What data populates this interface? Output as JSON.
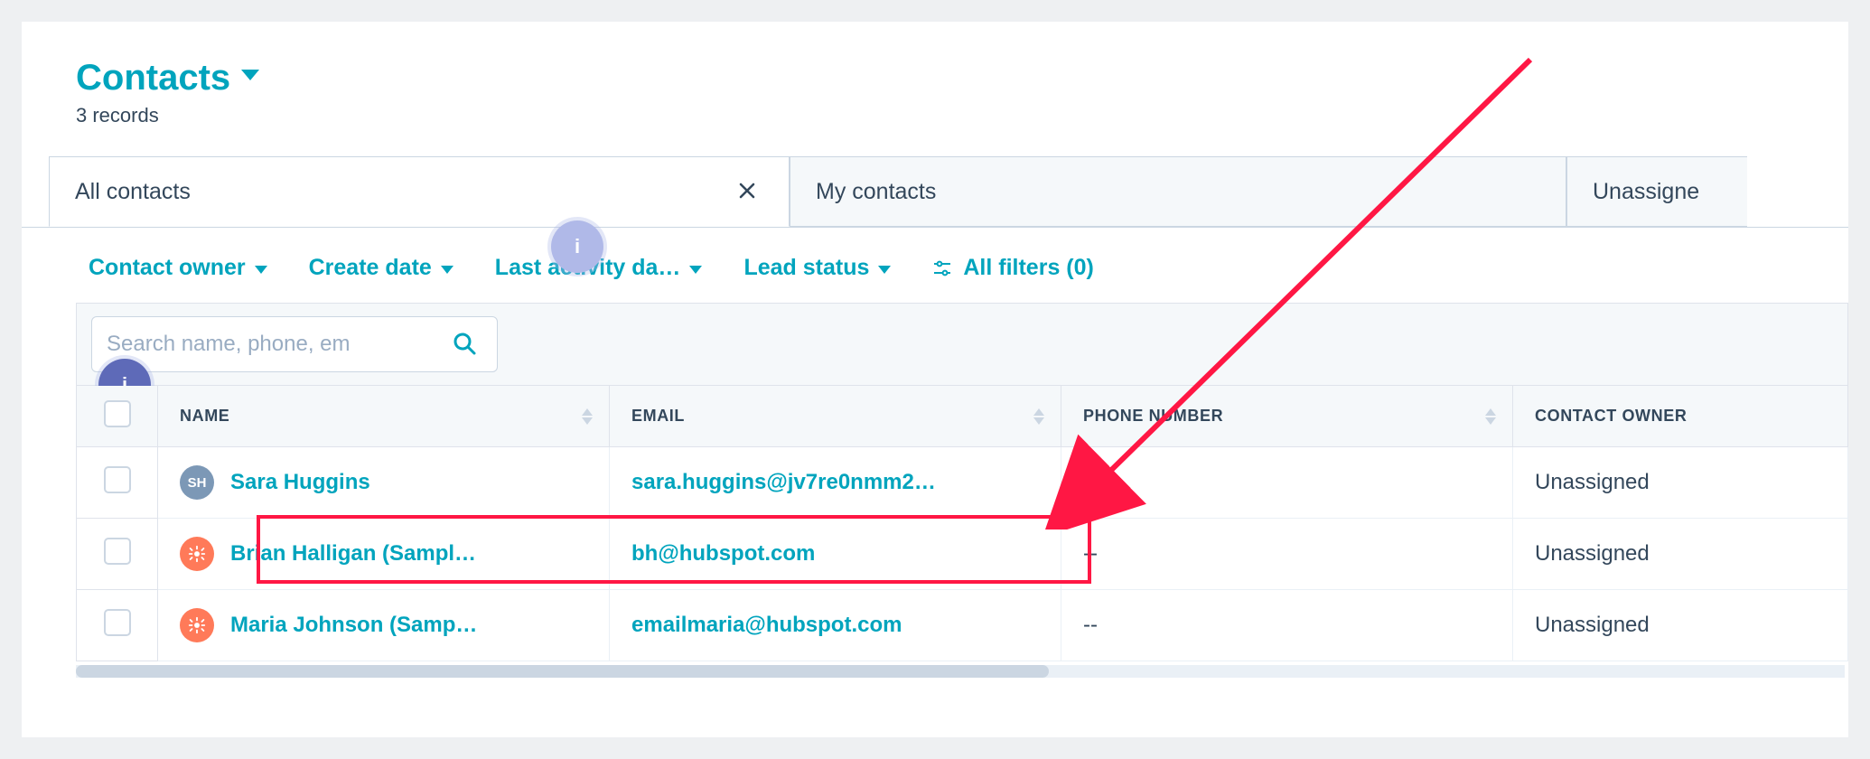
{
  "header": {
    "title": "Contacts",
    "records_label": "3 records"
  },
  "tabs": {
    "active": {
      "label": "All contacts"
    },
    "secondary": {
      "label": "My contacts"
    },
    "tertiary": {
      "label": "Unassigne"
    }
  },
  "filters": {
    "owner": "Contact owner",
    "create_date": "Create date",
    "last_activity": "Last activity da…",
    "lead_status": "Lead status",
    "all_filters": "All filters (0)"
  },
  "search": {
    "placeholder": "Search name, phone, em"
  },
  "columns": {
    "name": "NAME",
    "email": "EMAIL",
    "phone": "PHONE NUMBER",
    "owner": "CONTACT OWNER"
  },
  "rows": [
    {
      "avatar": {
        "type": "initials",
        "text": "SH",
        "bg": "#7c98b6"
      },
      "name": "Sara Huggins",
      "email": "sara.huggins@jv7re0nmm2…",
      "phone": "--",
      "owner": "Unassigned"
    },
    {
      "avatar": {
        "type": "sprocket",
        "bg": "#ff7a59"
      },
      "name": "Brian Halligan (Sampl…",
      "email": "bh@hubspot.com",
      "phone": "--",
      "owner": "Unassigned"
    },
    {
      "avatar": {
        "type": "sprocket",
        "bg": "#ff7a59"
      },
      "name": "Maria Johnson (Samp…",
      "email": "emailmaria@hubspot.com",
      "phone": "--",
      "owner": "Unassigned"
    }
  ],
  "info_badge_text": "i",
  "colors": {
    "accent": "#00a4bd",
    "highlight": "#ff1744"
  }
}
